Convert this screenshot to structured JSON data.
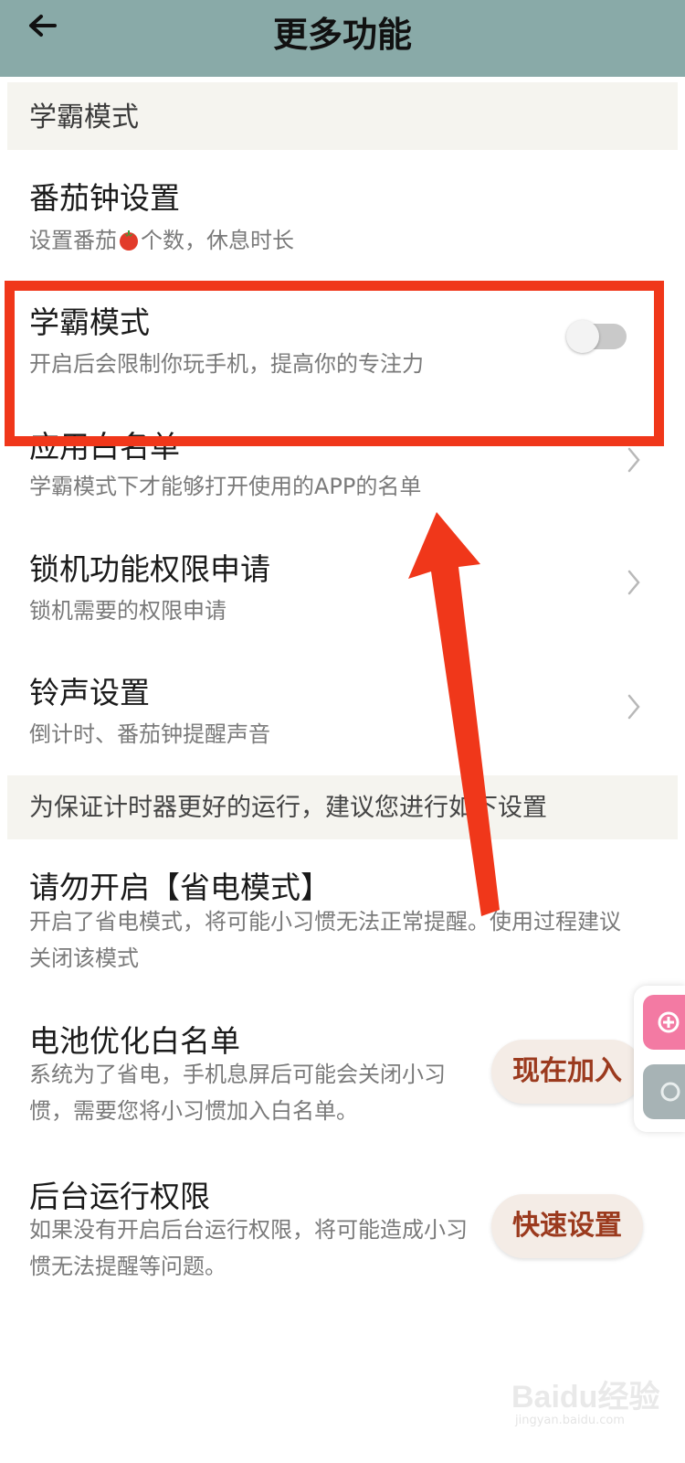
{
  "header": {
    "title": "更多功能",
    "back_icon": "arrow-left-icon",
    "background": "#89aaa8"
  },
  "section1": {
    "title": "学霸模式"
  },
  "items": [
    {
      "title": "番茄钟设置",
      "subtitle_before": "设置番茄",
      "subtitle_after": "个数，休息时长",
      "icon": "tomato-icon"
    },
    {
      "title": "学霸模式",
      "subtitle": "开启后会限制你玩手机，提高你的专注力",
      "toggle_on": false
    },
    {
      "title": "应用白名单",
      "subtitle": "学霸模式下才能够打开使用的APP的名单"
    },
    {
      "title": "锁机功能权限申请",
      "subtitle": "锁机需要的权限申请"
    },
    {
      "title": "铃声设置",
      "subtitle": "倒计时、番茄钟提醒声音"
    }
  ],
  "section2": {
    "title": "为保证计时器更好的运行，建议您进行如下设置"
  },
  "settings": [
    {
      "title": "请勿开启【省电模式】",
      "subtitle": "开启了省电模式，将可能小习惯无法正常提醒。使用过程建议关闭该模式"
    },
    {
      "title": "电池优化白名单",
      "subtitle": "系统为了省电，手机息屏后可能会关闭小习惯，需要您将小习惯加入白名单。",
      "button": "现在加入"
    },
    {
      "title": "后台运行权限",
      "subtitle": "如果没有开启后台运行权限，将可能造成小习惯无法提醒等问题。",
      "button": "快速设置"
    }
  ],
  "annotation": {
    "color": "#f0371a"
  },
  "watermark": {
    "text": "Baidu经验",
    "sub": "jingyan.baidu.com"
  }
}
